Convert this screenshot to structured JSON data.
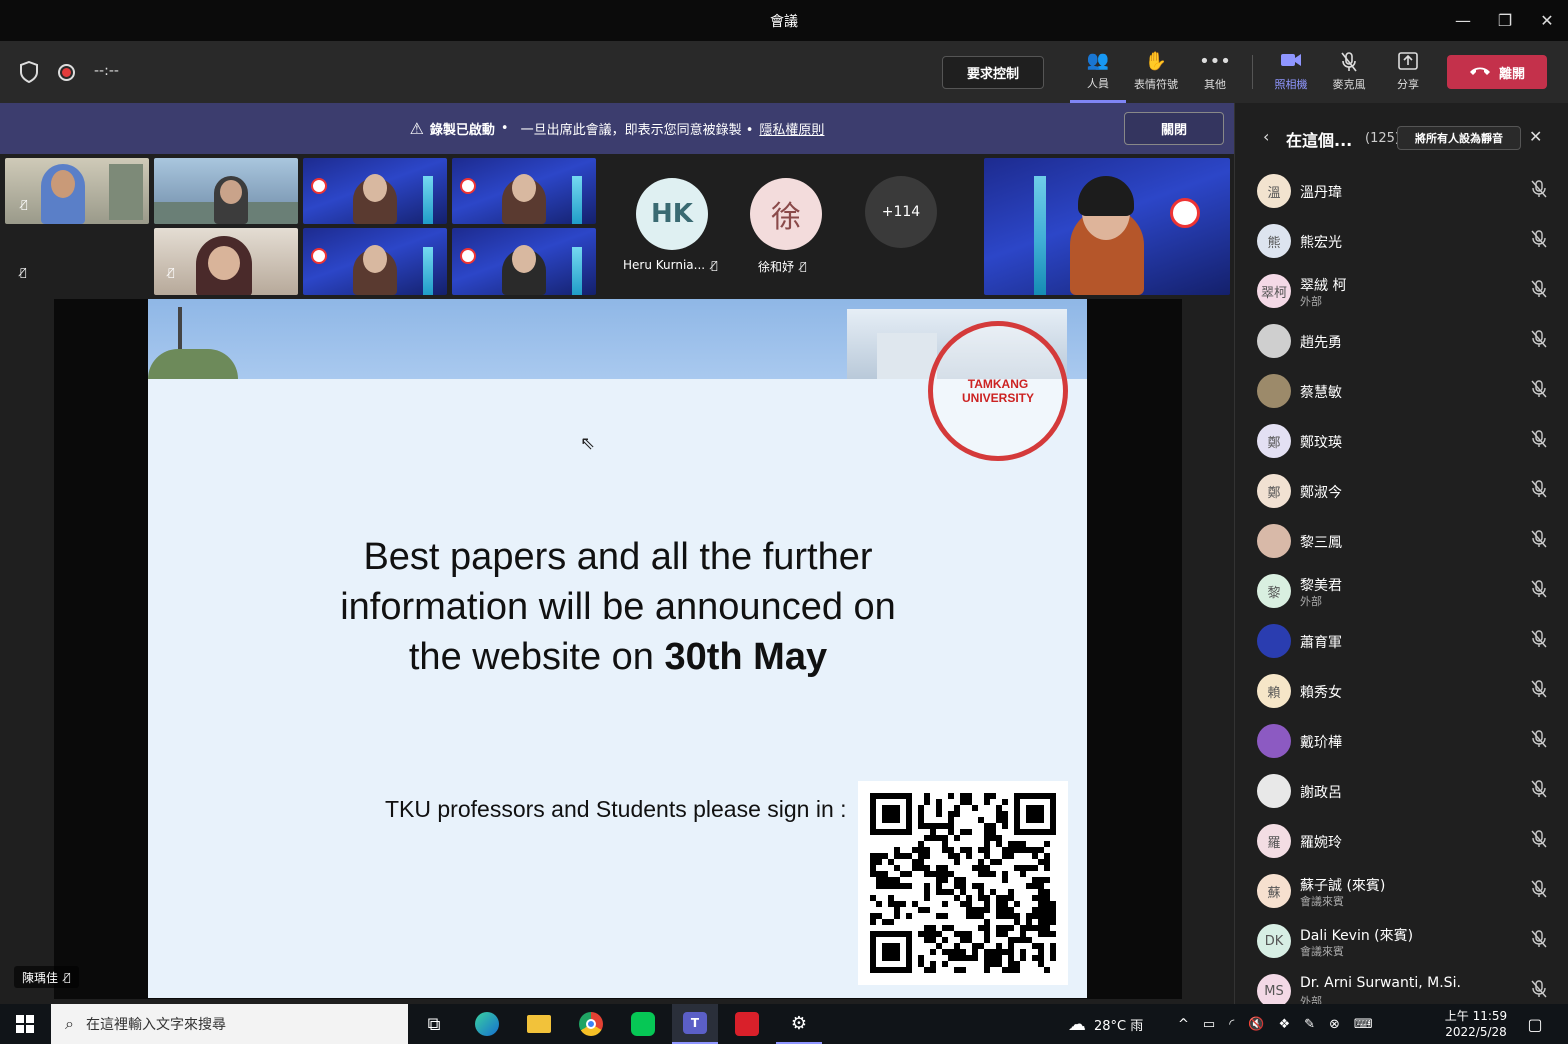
{
  "window": {
    "title": "會議",
    "minimize": "—",
    "restore": "❐",
    "close": "✕"
  },
  "toolbar": {
    "timer": "--:--",
    "request_control": "要求控制",
    "people": "人員",
    "reactions": "表情符號",
    "more": "其他",
    "camera": "照相機",
    "mic": "麥克風",
    "share": "分享",
    "leave": "離開"
  },
  "banner": {
    "bold": "錄製已啟動",
    "sep": "•",
    "text": "一旦出席此會議，即表示您同意被錄製 •",
    "link": "隱私權原則",
    "close": "關閉"
  },
  "stage": {
    "avatars": [
      {
        "initials": "HK",
        "name": "Heru Kurnia...",
        "bg": "#dff0f2",
        "fg": "#3a6a72"
      },
      {
        "initials": "徐",
        "name": "徐和妤",
        "bg": "#f3dcdc",
        "fg": "#8a4a4a"
      },
      {
        "initials": "+114",
        "name": "",
        "bg": "#3a3a3a",
        "fg": "#ffffff"
      }
    ],
    "speaker": "陳瑀佳"
  },
  "slide": {
    "line1": "Best papers and all the further",
    "line2": "information will be announced on",
    "line3_pre": "the website on ",
    "line3_bold": "30th May",
    "signin": "TKU professors and Students please sign in :",
    "seal_text": "TAMKANG UNIVERSITY"
  },
  "panel": {
    "title": "在這個...",
    "count": "(125)",
    "mute_all": "將所有人設為靜音",
    "close": "✕",
    "participants": [
      {
        "name": "溫丹瑋",
        "sub": "",
        "initial": "溫",
        "bg": "#f2e3cf"
      },
      {
        "name": "熊宏光",
        "sub": "",
        "initial": "熊",
        "bg": "#dde4ef"
      },
      {
        "name": "翠絨 柯",
        "sub": "外部",
        "initial": "翠柯",
        "bg": "#f4d9e6"
      },
      {
        "name": "趙先勇",
        "sub": "",
        "initial": "",
        "bg": "#cfcfcf"
      },
      {
        "name": "蔡慧敏",
        "sub": "",
        "initial": "",
        "bg": "#9c8a6a"
      },
      {
        "name": "鄭玟瑛",
        "sub": "",
        "initial": "鄭",
        "bg": "#e3e0f3"
      },
      {
        "name": "鄭淑今",
        "sub": "",
        "initial": "鄭",
        "bg": "#f1e1d2"
      },
      {
        "name": "黎三鳳",
        "sub": "",
        "initial": "",
        "bg": "#d8b9a8"
      },
      {
        "name": "黎美君",
        "sub": "外部",
        "initial": "黎",
        "bg": "#d9efe0"
      },
      {
        "name": "蕭育軍",
        "sub": "",
        "initial": "",
        "bg": "#2a3db0"
      },
      {
        "name": "賴秀女",
        "sub": "",
        "initial": "賴",
        "bg": "#f6e6c8"
      },
      {
        "name": "戴玠樺",
        "sub": "",
        "initial": "",
        "bg": "#8c5ac2"
      },
      {
        "name": "謝政呂",
        "sub": "",
        "initial": "",
        "bg": "#e8e8e8"
      },
      {
        "name": "羅婉玲",
        "sub": "",
        "initial": "羅",
        "bg": "#f3dde3"
      },
      {
        "name": "蘇子誠 (來賓)",
        "sub": "會議來賓",
        "initial": "蘇",
        "bg": "#f6e0cf"
      },
      {
        "name": "Dali Kevin (來賓)",
        "sub": "會議來賓",
        "initial": "DK",
        "bg": "#d7eee4"
      },
      {
        "name": "Dr. Arni Surwanti, M.Si.",
        "sub": "外部",
        "initial": "MS",
        "bg": "#f3d9e6"
      }
    ]
  },
  "taskbar": {
    "search_placeholder": "在這裡輸入文字來搜尋",
    "weather": "28°C 雨",
    "time": "上午 11:59",
    "date": "2022/5/28"
  },
  "colors": {
    "leave": "#c4314b",
    "banner": "#3c3d6e",
    "accent": "#7f85f5"
  }
}
